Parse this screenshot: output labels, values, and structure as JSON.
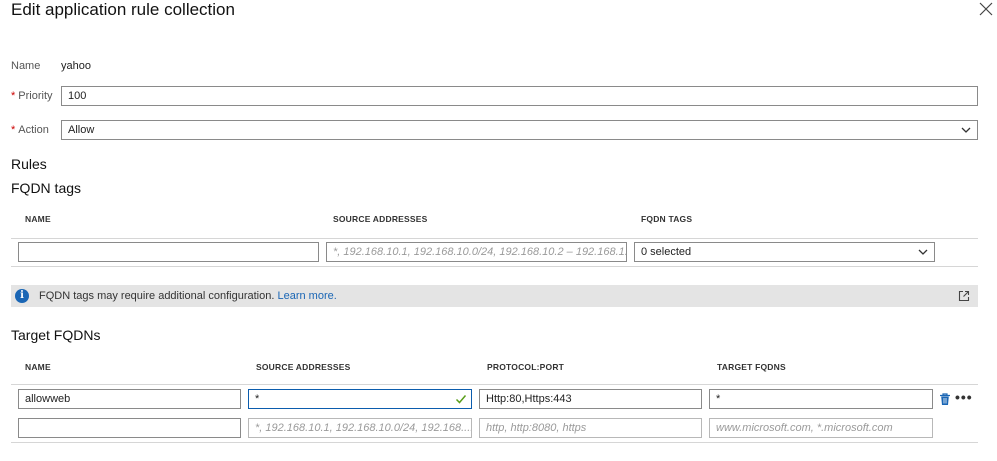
{
  "header": {
    "title": "Edit application rule collection"
  },
  "form": {
    "name_label": "Name",
    "name_value": "yahoo",
    "priority_label": "Priority",
    "priority_value": "100",
    "action_label": "Action",
    "action_value": "Allow",
    "required_mark": "*"
  },
  "rules_heading": "Rules",
  "fqdn_tags": {
    "heading": "FQDN tags",
    "columns": [
      "NAME",
      "SOURCE ADDRESSES",
      "FQDN TAGS"
    ],
    "row": {
      "name": "",
      "source_placeholder": "*, 192.168.10.1, 192.168.10.0/24, 192.168.10.2 – 192.168.1...",
      "tags_value": "0 selected"
    }
  },
  "info": {
    "text": "FQDN tags may require additional configuration.",
    "link": "Learn more."
  },
  "target_fqdns": {
    "heading": "Target FQDNs",
    "columns": [
      "NAME",
      "SOURCE ADDRESSES",
      "PROTOCOL:PORT",
      "TARGET FQDNS"
    ],
    "rows": [
      {
        "name": "allowweb",
        "source": "*",
        "protocol": "Http:80,Https:443",
        "target": "*"
      }
    ],
    "new_row": {
      "name": "",
      "source_placeholder": "*, 192.168.10.1, 192.168.10.0/24, 192.168....",
      "protocol_placeholder": "http, http:8080, https",
      "target_placeholder": "www.microsoft.com, *.microsoft.com"
    }
  },
  "icons": {
    "close": "close-icon",
    "chevron": "chevron-down-icon",
    "info": "info-icon",
    "external": "external-link-icon",
    "check": "check-icon",
    "delete": "trash-icon",
    "more": "more-icon"
  },
  "colors": {
    "accent": "#1a66b5",
    "required": "#c00000",
    "valid": "#5a9e1a"
  }
}
